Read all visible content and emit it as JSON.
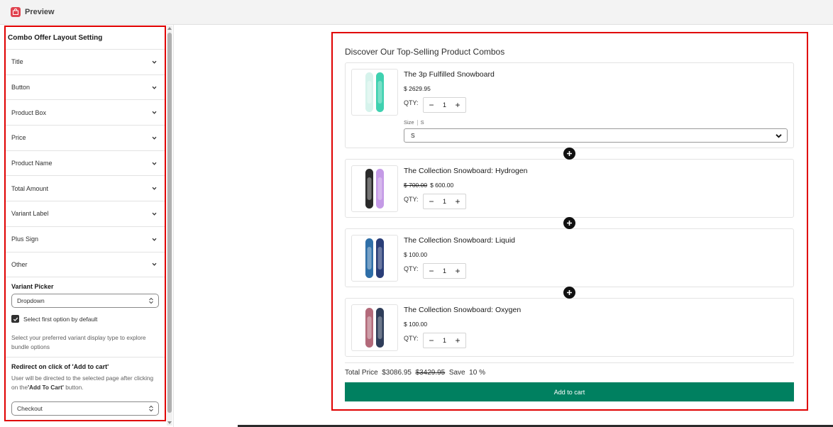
{
  "window": {
    "title": "Preview"
  },
  "settings": {
    "heading": "Combo Offer Layout Setting",
    "sections": [
      "Title",
      "Button",
      "Product Box",
      "Price",
      "Product Name",
      "Total Amount",
      "Variant Label",
      "Plus Sign",
      "Other"
    ],
    "variant_picker": {
      "label": "Variant Picker",
      "value": "Dropdown",
      "checkbox_label": "Select first option by default",
      "checkbox_checked": true,
      "help": "Select your preferred variant display type to explore bundle options"
    },
    "redirect": {
      "label": "Redirect on click of 'Add to cart'",
      "desc_prefix": "User will be directed to the selected page after clicking on the",
      "desc_bold": "'Add To Cart'",
      "desc_suffix": " button.",
      "value": "Checkout"
    }
  },
  "preview": {
    "heading": "Discover Our Top-Selling Product Combos",
    "qty_label": "QTY:",
    "products": [
      {
        "name": "The 3p Fulfilled Snowboard",
        "price": "$ 2629.95",
        "compare_price": "",
        "qty": "1",
        "variant_label": "Size",
        "variant_value_label": "S",
        "variant_selected": "S",
        "colors": [
          "#d6f3ec",
          "#3fd1b0"
        ]
      },
      {
        "name": "The Collection Snowboard: Hydrogen",
        "price": "$ 600.00",
        "compare_price": "$ 700.00",
        "qty": "1",
        "colors": [
          "#2a2a2a",
          "#c49ae6"
        ]
      },
      {
        "name": "The Collection Snowboard: Liquid",
        "price": "$ 100.00",
        "compare_price": "",
        "qty": "1",
        "colors": [
          "#2f6fa8",
          "#2a3e78"
        ]
      },
      {
        "name": "The Collection Snowboard: Oxygen",
        "price": "$ 100.00",
        "compare_price": "",
        "qty": "1",
        "colors": [
          "#b36a7a",
          "#2f3e5a"
        ]
      }
    ],
    "total": {
      "label": "Total Price",
      "price": "$3086.95",
      "compare_price": "$3429.95",
      "save_label": "Save",
      "save_value": "10 %"
    },
    "add_to_cart": "Add to cart"
  },
  "colors": {
    "accent_red": "#e00000",
    "cart_green": "#008060"
  }
}
